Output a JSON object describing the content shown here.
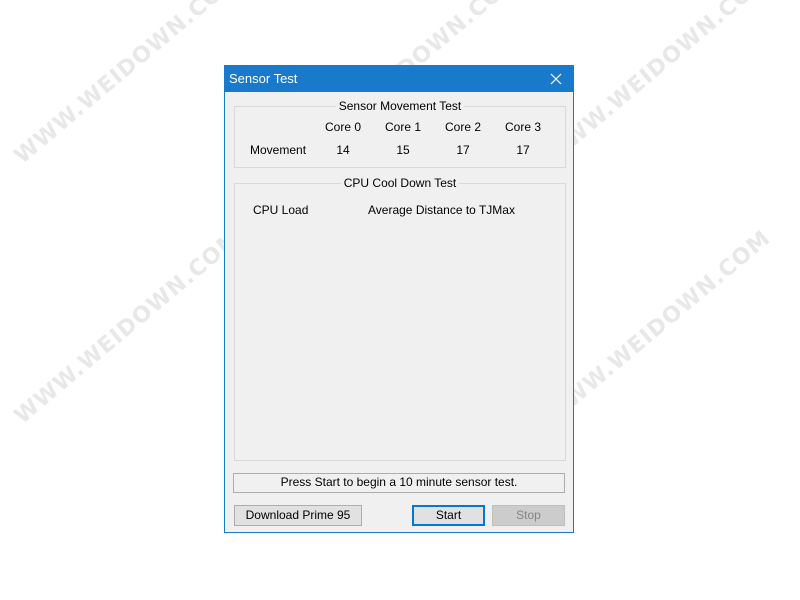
{
  "watermark": "WWW.WEIDOWN.COM",
  "window": {
    "title": "Sensor Test"
  },
  "movement_group": {
    "title": "Sensor Movement Test",
    "row_label": "Movement",
    "columns": [
      {
        "header": "Core 0",
        "value": "14"
      },
      {
        "header": "Core 1",
        "value": "15"
      },
      {
        "header": "Core 2",
        "value": "17"
      },
      {
        "header": "Core 3",
        "value": "17"
      }
    ]
  },
  "cooldown_group": {
    "title": "CPU Cool Down Test",
    "col_cpu_load": "CPU Load",
    "col_avg_distance": "Average Distance to TJMax"
  },
  "status": "Press Start to begin a 10 minute sensor test.",
  "buttons": {
    "download": "Download Prime 95",
    "start": "Start",
    "stop": "Stop"
  },
  "colors": {
    "titlebar": "#1979ca",
    "window_bg": "#f0f0f0",
    "default_button_border": "#0078d7"
  }
}
